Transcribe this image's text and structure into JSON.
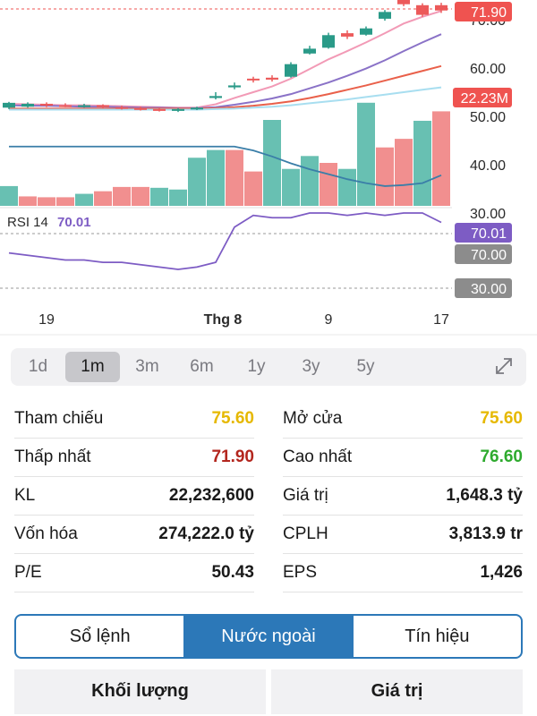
{
  "chart_data": {
    "type": "candlestick",
    "price_axis_labels": [
      "70.00",
      "60.00",
      "50.00",
      "40.00",
      "30.00"
    ],
    "price_ylim": [
      28,
      73.5
    ],
    "price_tag": "71.90",
    "volume_tag": "22.23M",
    "x_labels": [
      {
        "label": "19",
        "index": 2
      },
      {
        "label": "Thg 8",
        "index": 11
      },
      {
        "label": "9",
        "index": 17
      },
      {
        "label": "17",
        "index": 23
      }
    ],
    "candles": [
      {
        "o": 51.8,
        "c": 52.8,
        "h": 53.0,
        "l": 51.5,
        "up": true
      },
      {
        "o": 52.0,
        "c": 52.6,
        "h": 52.9,
        "l": 51.8,
        "up": true
      },
      {
        "o": 52.6,
        "c": 52.2,
        "h": 52.9,
        "l": 51.9,
        "up": false
      },
      {
        "o": 52.3,
        "c": 52.1,
        "h": 52.7,
        "l": 51.9,
        "up": false
      },
      {
        "o": 52.0,
        "c": 52.3,
        "h": 52.6,
        "l": 51.8,
        "up": true
      },
      {
        "o": 52.3,
        "c": 51.9,
        "h": 52.5,
        "l": 51.7,
        "up": false
      },
      {
        "o": 51.9,
        "c": 51.6,
        "h": 52.2,
        "l": 51.4,
        "up": false
      },
      {
        "o": 51.7,
        "c": 51.4,
        "h": 52.0,
        "l": 51.2,
        "up": false
      },
      {
        "o": 51.5,
        "c": 51.2,
        "h": 51.8,
        "l": 51.0,
        "up": false
      },
      {
        "o": 51.2,
        "c": 51.5,
        "h": 51.7,
        "l": 50.9,
        "up": true
      },
      {
        "o": 51.5,
        "c": 51.8,
        "h": 52.0,
        "l": 51.3,
        "up": true
      },
      {
        "o": 53.8,
        "c": 54.2,
        "h": 55.0,
        "l": 53.5,
        "up": true
      },
      {
        "o": 56.0,
        "c": 56.4,
        "h": 57.0,
        "l": 55.6,
        "up": true
      },
      {
        "o": 57.8,
        "c": 57.5,
        "h": 58.2,
        "l": 57.0,
        "up": false
      },
      {
        "o": 58.0,
        "c": 57.6,
        "h": 58.5,
        "l": 57.2,
        "up": false
      },
      {
        "o": 58.2,
        "c": 60.8,
        "h": 61.2,
        "l": 58.0,
        "up": true
      },
      {
        "o": 63.0,
        "c": 64.0,
        "h": 64.6,
        "l": 62.8,
        "up": true
      },
      {
        "o": 64.2,
        "c": 66.8,
        "h": 67.3,
        "l": 64.0,
        "up": true
      },
      {
        "o": 67.2,
        "c": 66.5,
        "h": 67.8,
        "l": 66.0,
        "up": false
      },
      {
        "o": 66.9,
        "c": 68.2,
        "h": 68.6,
        "l": 66.7,
        "up": true
      },
      {
        "o": 70.2,
        "c": 71.6,
        "h": 72.0,
        "l": 69.8,
        "up": true
      },
      {
        "o": 74.5,
        "c": 73.2,
        "h": 75.0,
        "l": 72.8,
        "up": false
      },
      {
        "o": 73.0,
        "c": 71.0,
        "h": 73.4,
        "l": 70.6,
        "up": false
      },
      {
        "o": 73.0,
        "c": 71.9,
        "h": 73.5,
        "l": 71.4,
        "up": false
      }
    ],
    "volume_bars": [
      {
        "v": 0.23,
        "up": true
      },
      {
        "v": 0.11,
        "up": false
      },
      {
        "v": 0.1,
        "up": false
      },
      {
        "v": 0.1,
        "up": false
      },
      {
        "v": 0.14,
        "up": true
      },
      {
        "v": 0.17,
        "up": false
      },
      {
        "v": 0.22,
        "up": false
      },
      {
        "v": 0.22,
        "up": false
      },
      {
        "v": 0.21,
        "up": true
      },
      {
        "v": 0.19,
        "up": true
      },
      {
        "v": 0.56,
        "up": true
      },
      {
        "v": 0.65,
        "up": true
      },
      {
        "v": 0.65,
        "up": false
      },
      {
        "v": 0.4,
        "up": false
      },
      {
        "v": 1.0,
        "up": true
      },
      {
        "v": 0.43,
        "up": true
      },
      {
        "v": 0.58,
        "up": true
      },
      {
        "v": 0.5,
        "up": false
      },
      {
        "v": 0.43,
        "up": true
      },
      {
        "v": 1.2,
        "up": true
      },
      {
        "v": 0.68,
        "up": false
      },
      {
        "v": 0.78,
        "up": false
      },
      {
        "v": 0.99,
        "up": true
      },
      {
        "v": 1.1,
        "up": false
      }
    ],
    "ma_lines": [
      {
        "color": "#f29ab6",
        "values": [
          52.6,
          52.5,
          52.4,
          52.3,
          52.3,
          52.2,
          52.1,
          52.0,
          51.9,
          51.8,
          51.8,
          52.5,
          53.8,
          55.0,
          56.2,
          57.8,
          59.8,
          61.8,
          63.5,
          65.3,
          67.2,
          69.2,
          70.6,
          71.8
        ]
      },
      {
        "color": "#8a72c7",
        "values": [
          52.3,
          52.2,
          52.2,
          52.1,
          52.0,
          52.0,
          51.9,
          51.8,
          51.8,
          51.7,
          51.7,
          51.9,
          52.4,
          53.0,
          53.7,
          54.6,
          55.8,
          57.0,
          58.4,
          59.9,
          61.6,
          63.5,
          65.3,
          67.0
        ]
      },
      {
        "color": "#e9604a",
        "values": [
          51.6,
          51.6,
          51.6,
          51.6,
          51.6,
          51.6,
          51.6,
          51.6,
          51.6,
          51.6,
          51.6,
          51.7,
          51.9,
          52.2,
          52.6,
          53.1,
          53.8,
          54.6,
          55.5,
          56.4,
          57.4,
          58.4,
          59.4,
          60.4
        ]
      },
      {
        "color": "#a8def0",
        "values": [
          51.4,
          51.4,
          51.4,
          51.4,
          51.4,
          51.4,
          51.4,
          51.4,
          51.4,
          51.4,
          51.4,
          51.5,
          51.6,
          51.8,
          52.0,
          52.3,
          52.7,
          53.1,
          53.5,
          54.0,
          54.5,
          55.0,
          55.5,
          56.0
        ]
      }
    ],
    "volume_ma": [
      0.6,
      0.6,
      0.6,
      0.6,
      0.6,
      0.6,
      0.6,
      0.6,
      0.6,
      0.6,
      0.6,
      0.6,
      0.6,
      0.56,
      0.5,
      0.43,
      0.37,
      0.32,
      0.27,
      0.23,
      0.2,
      0.21,
      0.23,
      0.31
    ],
    "rsi": {
      "label": "RSI 14",
      "value_label": "70.01",
      "tags": [
        "70.01",
        "70.00",
        "30.00"
      ],
      "levels": [
        70,
        30
      ],
      "ylim": [
        18,
        82
      ],
      "values": [
        48,
        46,
        44,
        42,
        42,
        40,
        40,
        38,
        36,
        34,
        36,
        40,
        70,
        80,
        78,
        78,
        82,
        82,
        80,
        82,
        80,
        82,
        82,
        74
      ]
    }
  },
  "timeframes": {
    "items": [
      "1d",
      "1m",
      "3m",
      "6m",
      "1y",
      "3y",
      "5y"
    ],
    "selected": "1m"
  },
  "stats": {
    "left": [
      {
        "label": "Tham chiếu",
        "value": "75.60",
        "color": "#e6b800"
      },
      {
        "label": "Thấp nhất",
        "value": "71.90",
        "color": "#b3261e"
      },
      {
        "label": "KL",
        "value": "22,232,600",
        "color": "#1a1a1a"
      },
      {
        "label": "Vốn hóa",
        "value": "274,222.0 tỷ",
        "color": "#1a1a1a"
      },
      {
        "label": "P/E",
        "value": "50.43",
        "color": "#1a1a1a"
      }
    ],
    "right": [
      {
        "label": "Mở cửa",
        "value": "75.60",
        "color": "#e6b800"
      },
      {
        "label": "Cao nhất",
        "value": "76.60",
        "color": "#2eaa2e"
      },
      {
        "label": "Giá trị",
        "value": "1,648.3 tỷ",
        "color": "#1a1a1a"
      },
      {
        "label": "CPLH",
        "value": "3,813.9 tr",
        "color": "#1a1a1a"
      },
      {
        "label": "EPS",
        "value": "1,426",
        "color": "#1a1a1a"
      }
    ]
  },
  "tabs": {
    "items": [
      "Sổ lệnh",
      "Nước ngoài",
      "Tín hiệu"
    ],
    "selected": "Nước ngoài"
  },
  "footer": {
    "volume_label": "Khối lượng",
    "value_label": "Giá trị"
  },
  "colors": {
    "up": "#4eb5a4",
    "down": "#ef7b7b",
    "accent": "#2c78b8",
    "rsi": "#7d5cc4"
  }
}
